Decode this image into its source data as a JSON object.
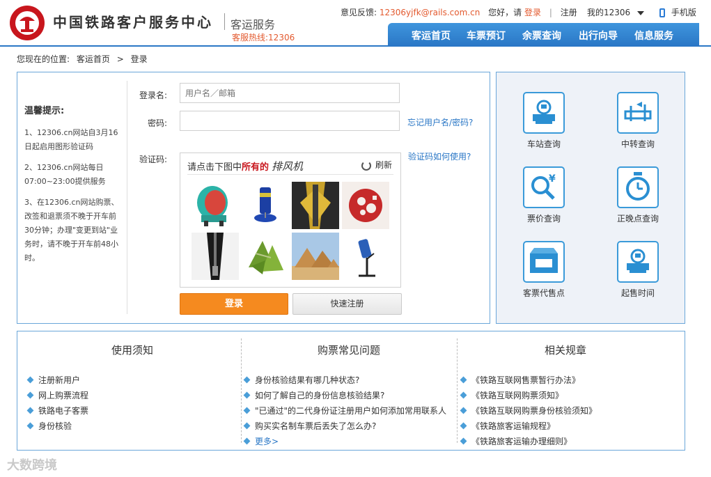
{
  "header": {
    "site_name": "中国铁路客户服务中心",
    "sub_title": "客运服务",
    "hotline": "客服热线:12306",
    "feedback_label": "意见反馈:",
    "feedback_email": "12306yjfk@rails.com.cn",
    "greeting": "您好，请",
    "login_link": "登录",
    "separator": "|",
    "register_link": "注册",
    "my_account": "我的12306",
    "mobile": "手机版"
  },
  "nav": {
    "items": [
      "客运首页",
      "车票预订",
      "余票查询",
      "出行向导",
      "信息服务"
    ]
  },
  "breadcrumb": {
    "prefix": "您现在的位置:",
    "home": "客运首页",
    "arrow": ">",
    "current": "登录"
  },
  "tips": {
    "title": "温馨提示:",
    "items": [
      "1、12306.cn网站自3月16日起启用图形验证码",
      "2、12306.cn网站每日07:00~23:00提供服务",
      "3、在12306.cn网站购票、改签和退票须不晚于开车前30分钟；办理\"变更到站\"业务时，请不晚于开车前48小时。"
    ]
  },
  "form": {
    "username_label": "登录名:",
    "username_placeholder": "用户名／邮箱",
    "password_label": "密码:",
    "forgot_link": "忘记用户名/密码?",
    "captcha_label": "验证码:",
    "captcha_help_link": "验证码如何使用?",
    "captcha_prompt_pre": "请点击下图中",
    "captcha_prompt_key": "所有的",
    "captcha_prompt_word": "排风机",
    "refresh_label": "刷新",
    "login_button": "登录",
    "register_button": "快速注册"
  },
  "captcha_images": [
    "exhaust-fan",
    "blue-cylinder-fan",
    "zipper-gold",
    "red-paper-cut",
    "black-zipper",
    "rice-dumplings",
    "pyramids",
    "lamp-fan"
  ],
  "services": [
    {
      "label": "车站查询",
      "icon": "station-icon"
    },
    {
      "label": "中转查询",
      "icon": "transfer-icon"
    },
    {
      "label": "票价查询",
      "icon": "price-search-icon"
    },
    {
      "label": "正晚点查询",
      "icon": "clock-icon"
    },
    {
      "label": "客票代售点",
      "icon": "ticket-agency-icon"
    },
    {
      "label": "起售时间",
      "icon": "sale-time-icon"
    }
  ],
  "info": {
    "col1": {
      "title": "使用须知",
      "items": [
        "注册新用户",
        "网上购票流程",
        "铁路电子客票",
        "身份核验"
      ]
    },
    "col2": {
      "title": "购票常见问题",
      "items": [
        "身份核验结果有哪几种状态?",
        "如何了解自己的身份信息核验结果?",
        "\"已通过\"的二代身份证注册用户如何添加常用联系人",
        "购买实名制车票后丢失了怎么办?"
      ],
      "more": "更多>"
    },
    "col3": {
      "title": "相关规章",
      "items": [
        "《铁路互联网售票暂行办法》",
        "《铁路互联网购票须知》",
        "《铁路互联网购票身份核验须知》",
        "《铁路旅客运输规程》",
        "《铁路旅客运输办理细则》"
      ]
    }
  },
  "watermark": "大数跨境",
  "colors": {
    "brand_red": "#c8161d",
    "nav_blue": "#2a77c6",
    "orange": "#f58a1f",
    "link_orange": "#e35a2f"
  }
}
